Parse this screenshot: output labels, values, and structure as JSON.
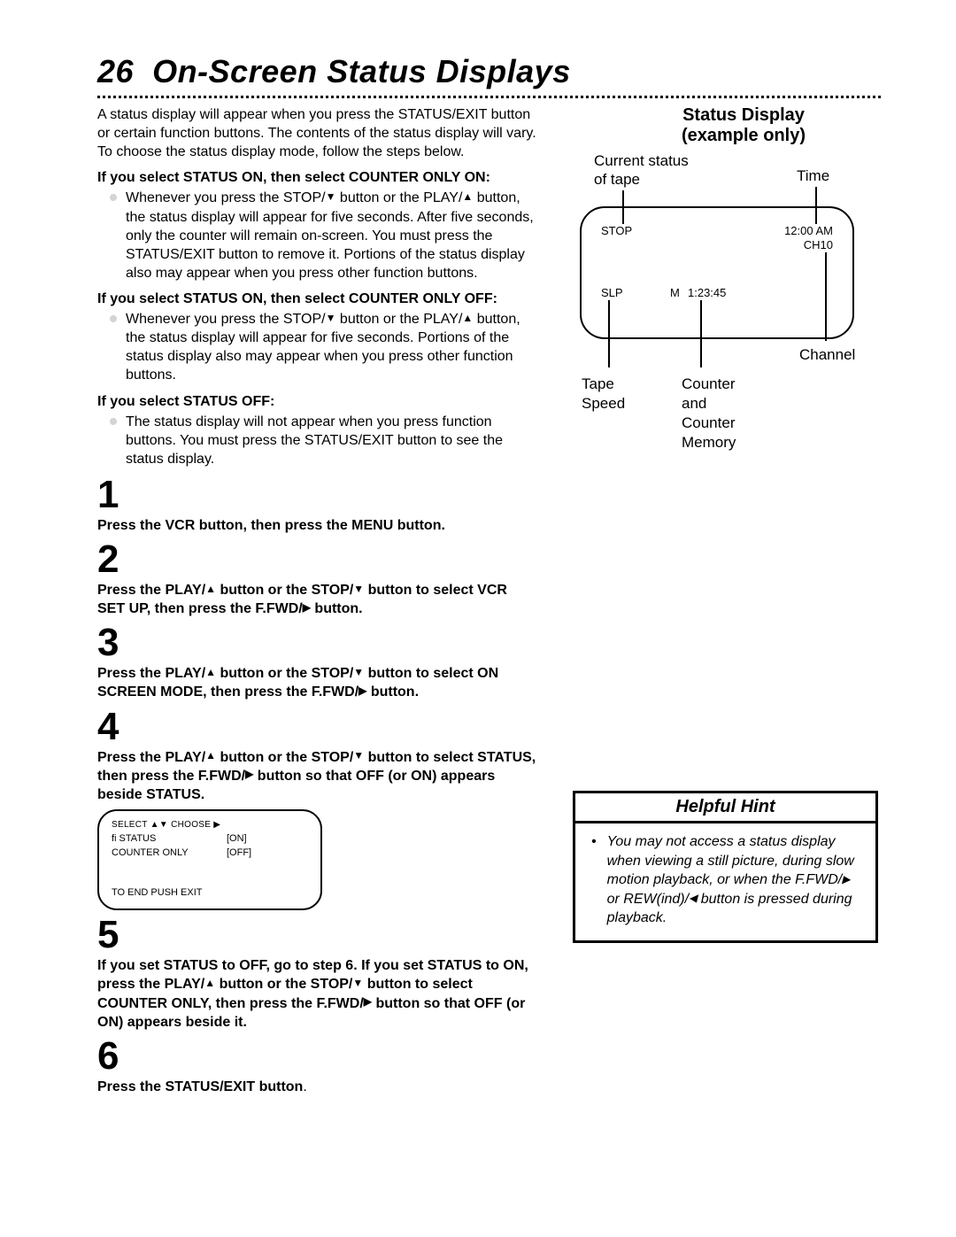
{
  "pageNumber": "26",
  "pageTitle": "On-Screen Status Displays",
  "intro": "A status display will appear when you press the STATUS/EXIT button or certain function buttons. The contents of the status display will vary. To choose the status display mode, follow the steps below.",
  "sec1head": "If you select STATUS ON, then select COUNTER ONLY ON:",
  "sec1body_a": "Whenever you press the STOP/",
  "sec1body_b": " button or the PLAY/",
  "sec1body_c": " button, the status display will appear for five seconds. After five seconds, only the counter will remain on-screen. You must press the STATUS/EXIT button to remove it. Portions of the status display also may appear when you press other function buttons.",
  "sec2head": "If you select STATUS ON, then select COUNTER ONLY OFF:",
  "sec2body_a": "Whenever you press the STOP/",
  "sec2body_b": " button or the PLAY/",
  "sec2body_c": " button, the status display will appear for five seconds. Portions of the status display also may appear when you press other function buttons.",
  "sec3head": "If you select STATUS OFF:",
  "sec3body": "The status display will not appear when you press function buttons. You must press the STATUS/EXIT button to see the status display.",
  "step1num": "1",
  "step1text": "Press the VCR button, then press the MENU button.",
  "step2num": "2",
  "step2a": "Press the PLAY/",
  "step2b": " button or the STOP/",
  "step2c": " button to select VCR SET UP, then press the F.FWD/",
  "step2d": " button.",
  "step3num": "3",
  "step3a": "Press the PLAY/",
  "step3b": " button or the STOP/",
  "step3c": " button to select ON SCREEN MODE, then press the F.FWD/",
  "step3d": " button.",
  "step4num": "4",
  "step4a": "Press the PLAY/",
  "step4b": " button or the STOP/",
  "step4c": " button to select STATUS, then press the F.FWD/",
  "step4d": " button so that OFF (or ON) appears beside STATUS.",
  "tv_select": "SELECT ▲▼ CHOOSE ▶",
  "tv_status_l": "ﬁ  STATUS",
  "tv_status_v": "[ON]",
  "tv_counter_l": "   COUNTER ONLY",
  "tv_counter_v": "[OFF]",
  "tv_footer": "TO END PUSH EXIT",
  "step5num": "5",
  "step5a": "If you set STATUS to OFF, go to step 6. If you set STATUS to ON, press the PLAY/",
  "step5b": " button or the STOP/",
  "step5c": " button to select COUNTER ONLY, then press the F.FWD/",
  "step5d": " button so that OFF (or ON) appears beside it.",
  "step6num": "6",
  "step6text_a": "Press the STATUS/EXIT button",
  "step6text_b": ".",
  "sd_title1": "Status Display",
  "sd_title2": "(example only)",
  "sd_cur1": "Current status",
  "sd_cur2": "of tape",
  "sd_time": "Time",
  "sd_stop": "STOP",
  "sd_clock": "12:00 AM",
  "sd_ch": "CH10",
  "sd_slp": "SLP",
  "sd_m": "M",
  "sd_cnt": "1:23:45",
  "sd_channel": "Channel",
  "sd_tape1": "Tape",
  "sd_tape2": "Speed",
  "sd_counter1": "Counter",
  "sd_counter2": "and",
  "sd_counter3": "Counter",
  "sd_counter4": "Memory",
  "hint_title": "Helpful Hint",
  "hint_a": "You may not access a status display when viewing a still picture, during slow motion playback, or when the F.FWD/",
  "hint_b": " or REW(ind)/",
  "hint_c": " button is pressed during playback."
}
